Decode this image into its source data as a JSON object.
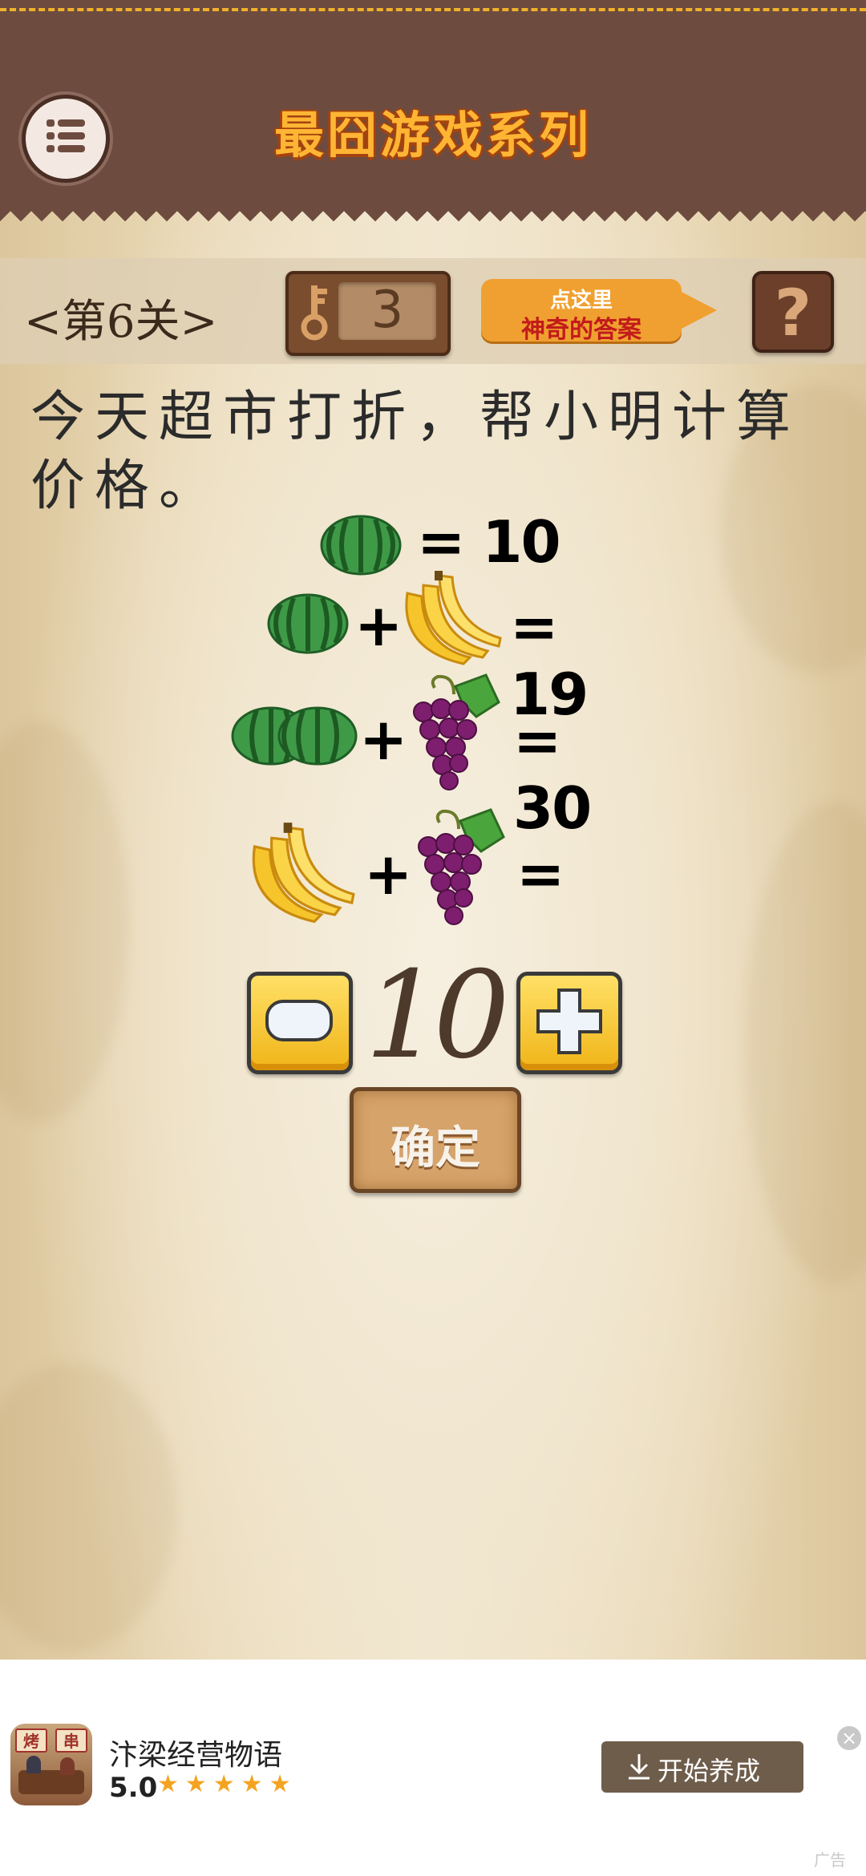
{
  "header": {
    "title": "最囧游戏系列",
    "menu_icon": "list-icon"
  },
  "level_bar": {
    "level_label": "<第6关>",
    "key_icon": "key-icon",
    "key_count": "3",
    "answer_hint": {
      "line1": "点这里",
      "line2": "神奇的答案"
    },
    "help_label": "?"
  },
  "puzzle": {
    "question": "今天超市打折，帮小明计算价格。",
    "equations": [
      {
        "items": [
          "watermelon"
        ],
        "result": "= 10"
      },
      {
        "items": [
          "watermelon",
          "+",
          "bananas"
        ],
        "result": "= 19"
      },
      {
        "items": [
          "two-watermelons",
          "+",
          "grapes"
        ],
        "result": "= 30"
      },
      {
        "items": [
          "bananas",
          "+",
          "grapes"
        ],
        "result": "="
      }
    ],
    "plus": "+",
    "answer_value": "10",
    "confirm_label": "确定"
  },
  "ad": {
    "icon_text": [
      "烤",
      "串"
    ],
    "title": "汴梁经营物语",
    "rating": "5.0",
    "stars": "★★★★★",
    "button_label": "开始养成",
    "tag": "广告"
  },
  "colors": {
    "header_bg": "#6d4c3f",
    "title_orange": "#ffb534",
    "hint_orange": "#f0a030",
    "hint_red": "#c21b1b",
    "ad_button": "#6f5d4c"
  }
}
